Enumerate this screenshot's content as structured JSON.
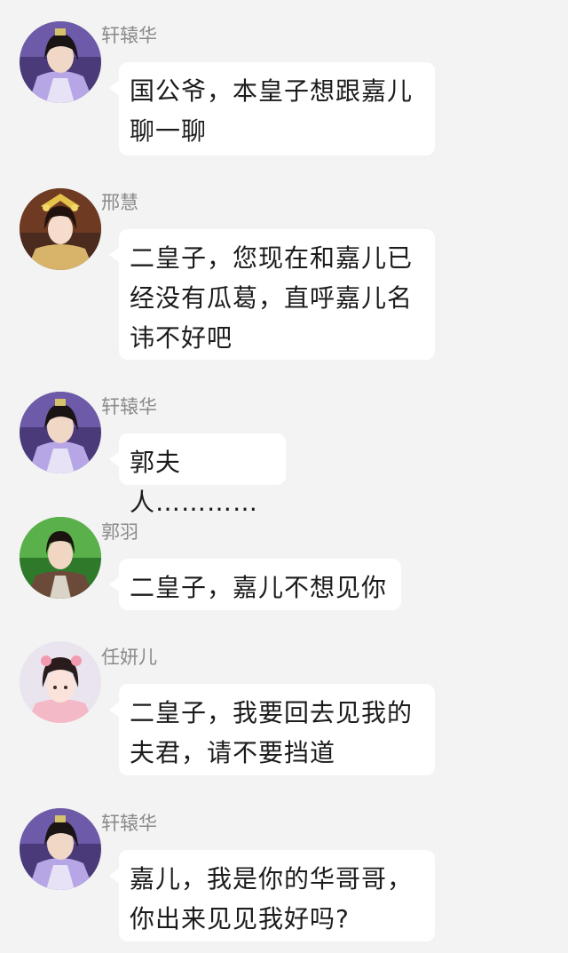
{
  "messages": [
    {
      "sender": "轩辕华",
      "avatar": "avatar-xuanyuanhua-icon",
      "text": "国公爷，本皇子想跟嘉儿\n聊一聊"
    },
    {
      "sender": "邢慧",
      "avatar": "avatar-xinghui-icon",
      "text": "二皇子，您现在和嘉儿已\n经没有瓜葛，直呼嘉儿名\n讳不好吧"
    },
    {
      "sender": "轩辕华",
      "avatar": "avatar-xuanyuanhua-icon",
      "text": "郭夫人…………"
    },
    {
      "sender": "郭羽",
      "avatar": "avatar-guoyu-icon",
      "text": "二皇子，嘉儿不想见你"
    },
    {
      "sender": "任妍儿",
      "avatar": "avatar-renyaner-icon",
      "text": "二皇子，我要回去见我的\n夫君，请不要挡道"
    },
    {
      "sender": "轩辕华",
      "avatar": "avatar-xuanyuanhua-icon",
      "text": "嘉儿，我是你的华哥哥，\n你出来见见我好吗?"
    }
  ],
  "colors": {
    "background": "#f3f3f3",
    "bubble": "#ffffff",
    "name": "#8a8a8a",
    "text": "#1c1c1c"
  }
}
